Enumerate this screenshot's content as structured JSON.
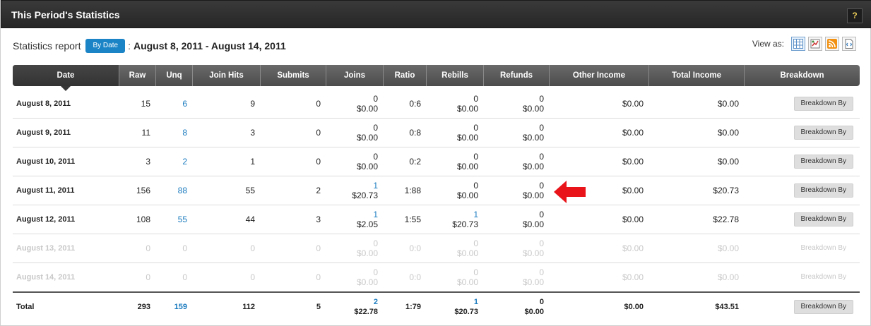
{
  "panel": {
    "title": "This Period's Statistics",
    "help_label": "?"
  },
  "report": {
    "label": "Statistics report",
    "by_date_label": "By Date",
    "separator": ":",
    "date_range": "August 8, 2011 - August 14, 2011"
  },
  "view_as": {
    "label": "View as:",
    "icons": [
      "grid-view-icon",
      "chart-view-icon",
      "rss-feed-icon",
      "xml-export-icon"
    ]
  },
  "columns": [
    "Date",
    "Raw",
    "Unq",
    "Join Hits",
    "Submits",
    "Joins",
    "Ratio",
    "Rebills",
    "Refunds",
    "Other Income",
    "Total Income",
    "Breakdown"
  ],
  "rows": [
    {
      "date": "August 8, 2011",
      "raw": "15",
      "unq": "6",
      "join_hits": "9",
      "submits": "0",
      "joins_count": "0",
      "joins_amount": "$0.00",
      "ratio": "0:6",
      "rebills_count": "0",
      "rebills_amount": "$0.00",
      "refunds_count": "0",
      "refunds_amount": "$0.00",
      "other_income": "$0.00",
      "total_income": "$0.00",
      "breakdown": "Breakdown By"
    },
    {
      "date": "August 9, 2011",
      "raw": "11",
      "unq": "8",
      "join_hits": "3",
      "submits": "0",
      "joins_count": "0",
      "joins_amount": "$0.00",
      "ratio": "0:8",
      "rebills_count": "0",
      "rebills_amount": "$0.00",
      "refunds_count": "0",
      "refunds_amount": "$0.00",
      "other_income": "$0.00",
      "total_income": "$0.00",
      "breakdown": "Breakdown By"
    },
    {
      "date": "August 10, 2011",
      "raw": "3",
      "unq": "2",
      "join_hits": "1",
      "submits": "0",
      "joins_count": "0",
      "joins_amount": "$0.00",
      "ratio": "0:2",
      "rebills_count": "0",
      "rebills_amount": "$0.00",
      "refunds_count": "0",
      "refunds_amount": "$0.00",
      "other_income": "$0.00",
      "total_income": "$0.00",
      "breakdown": "Breakdown By"
    },
    {
      "date": "August 11, 2011",
      "raw": "156",
      "unq": "88",
      "join_hits": "55",
      "submits": "2",
      "joins_count": "1",
      "joins_amount": "$20.73",
      "ratio": "1:88",
      "rebills_count": "0",
      "rebills_amount": "$0.00",
      "refunds_count": "0",
      "refunds_amount": "$0.00",
      "other_income": "$0.00",
      "total_income": "$20.73",
      "breakdown": "Breakdown By"
    },
    {
      "date": "August 12, 2011",
      "raw": "108",
      "unq": "55",
      "join_hits": "44",
      "submits": "3",
      "joins_count": "1",
      "joins_amount": "$2.05",
      "ratio": "1:55",
      "rebills_count": "1",
      "rebills_amount": "$20.73",
      "refunds_count": "0",
      "refunds_amount": "$0.00",
      "other_income": "$0.00",
      "total_income": "$22.78",
      "breakdown": "Breakdown By"
    },
    {
      "date": "August 13, 2011",
      "raw": "0",
      "unq": "0",
      "join_hits": "0",
      "submits": "0",
      "joins_count": "0",
      "joins_amount": "$0.00",
      "ratio": "0:0",
      "rebills_count": "0",
      "rebills_amount": "$0.00",
      "refunds_count": "0",
      "refunds_amount": "$0.00",
      "other_income": "$0.00",
      "total_income": "$0.00",
      "breakdown": "Breakdown By"
    },
    {
      "date": "August 14, 2011",
      "raw": "0",
      "unq": "0",
      "join_hits": "0",
      "submits": "0",
      "joins_count": "0",
      "joins_amount": "$0.00",
      "ratio": "0:0",
      "rebills_count": "0",
      "rebills_amount": "$0.00",
      "refunds_count": "0",
      "refunds_amount": "$0.00",
      "other_income": "$0.00",
      "total_income": "$0.00",
      "breakdown": "Breakdown By"
    }
  ],
  "total": {
    "date": "Total",
    "raw": "293",
    "unq": "159",
    "join_hits": "112",
    "submits": "5",
    "joins_count": "2",
    "joins_amount": "$22.78",
    "ratio": "1:79",
    "rebills_count": "1",
    "rebills_amount": "$20.73",
    "refunds_count": "0",
    "refunds_amount": "$0.00",
    "other_income": "$0.00",
    "total_income": "$43.51",
    "breakdown": "Breakdown By"
  },
  "annotation": {
    "icon": "red-arrow-icon",
    "color": "#e8141a"
  },
  "colors": {
    "link": "#1a7bbf",
    "button": "#1b84c6",
    "header": "#5a5a5a"
  }
}
